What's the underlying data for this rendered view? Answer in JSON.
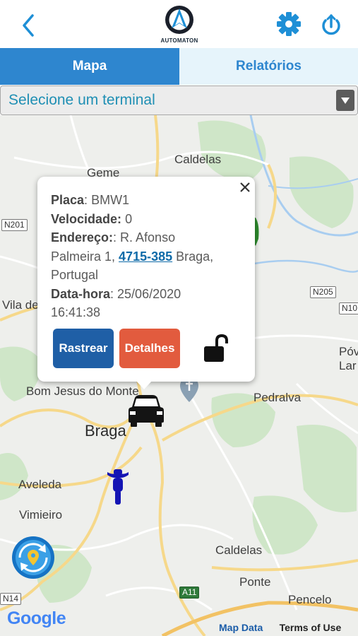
{
  "header": {
    "logo_text": "AUTOMATON",
    "accent_color": "#1e8fd6",
    "icons": [
      "chevron-left-icon",
      "gear-icon",
      "power-icon"
    ]
  },
  "tabs": [
    {
      "label": "Mapa",
      "active": true
    },
    {
      "label": "Relatórios",
      "active": false
    }
  ],
  "terminal_select": {
    "selected": "Selecione um terminal"
  },
  "map": {
    "labels": [
      "Caldelas",
      "Geme",
      "Vila de",
      "Pedralva",
      "Bom Jesus do Monte",
      "Braga",
      "Aveleda",
      "Vimieiro",
      "Caldelas",
      "Ponte",
      "Pencelo",
      "Póv",
      "Lar"
    ],
    "road_shields": [
      "N201",
      "N205",
      "N10",
      "A11",
      "N14"
    ],
    "attribution": {
      "google": "Google",
      "map_data": "Map Data",
      "terms": "Terms of Use"
    }
  },
  "popup": {
    "plate_label": "Placa",
    "plate": "BMW1",
    "speed_label": "Velocidade",
    "speed": "0",
    "address_label": "Endereço:",
    "address_line1": ": R. Afonso",
    "address_line2_pre": "Palmeira 1, ",
    "address_postal": "4715-385",
    "address_line2_post": " Braga,",
    "address_line3": "Portugal",
    "datetime_label": "Data-hora",
    "datetime_1": "25/06/2020",
    "datetime_2": "16:41:38",
    "track_button": "Rastrear",
    "details_button": "Detalhes",
    "track_color": "#1f5fa6",
    "details_color": "#e25b3e"
  }
}
